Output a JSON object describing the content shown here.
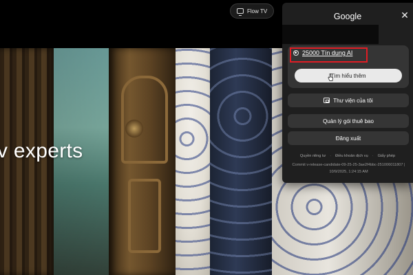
{
  "header": {
    "flow_button_label": "Flow TV",
    "flow_icon": "tv-icon"
  },
  "hero": {
    "headline_partial": "v experts"
  },
  "account_panel": {
    "title": "Google",
    "close_icon": "close-icon",
    "credits": {
      "label": "25000 Tín dụng AI",
      "icon": "coin-icon",
      "highlight_color": "#e11d24"
    },
    "learn_more_label": "Tìm hiểu thêm",
    "menu": [
      {
        "label": "Thư viện của tôi",
        "icon": "library-icon"
      },
      {
        "label": "Quản lý gói thuê bao"
      },
      {
        "label": "Đăng xuất"
      }
    ],
    "footer_links": [
      "Quyền riêng tư",
      "Điều khoản dịch vụ",
      "Giấy phép"
    ],
    "build_info": "Commit v-release-candidate-09-25-25-3ae2f4bbc-251006011807 | 10/9/2025, 1:24:15 AM"
  },
  "colors": {
    "panel_bg": "#1f1f1f",
    "button_bg": "#353535",
    "primary_button_bg": "#e9e9e9",
    "highlight": "#e11d24"
  }
}
